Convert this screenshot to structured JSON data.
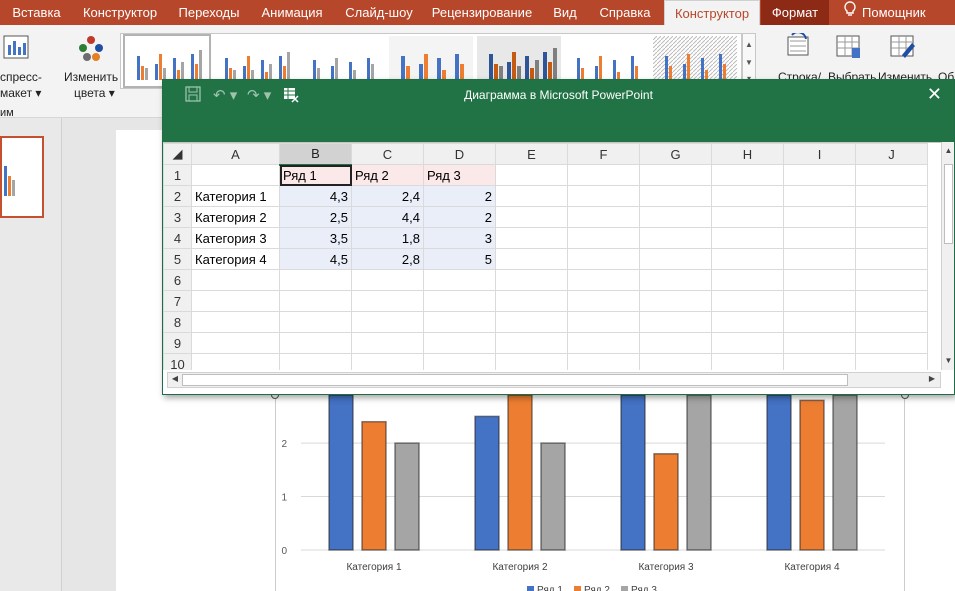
{
  "ribbon": {
    "tabs": [
      "Вставка",
      "Конструктор",
      "Переходы",
      "Анимация",
      "Слайд-шоу",
      "Рецензирование",
      "Вид",
      "Справка",
      "Конструктор",
      "Формат",
      "Помощник"
    ],
    "active_tab_index": 8,
    "left_group": {
      "line1": "спресс-",
      "line2": "макет",
      "line3": "им"
    },
    "change_colors": {
      "line1": "Изменить",
      "line2": "цвета"
    },
    "right_buttons": [
      "Строка/",
      "Выбрать",
      "Изменить",
      "Об"
    ],
    "colors": {
      "tab_bar": "#b7472a",
      "format_tab": "#8c2a16"
    }
  },
  "excel": {
    "title": "Диаграмма в Microsoft PowerPoint",
    "columns": [
      "A",
      "B",
      "C",
      "D",
      "E",
      "F",
      "G",
      "H",
      "I",
      "J"
    ],
    "rows": [
      [
        "",
        "Ряд 1",
        "Ряд 2",
        "Ряд 3",
        "",
        "",
        "",
        "",
        "",
        ""
      ],
      [
        "Категория 1",
        "4,3",
        "2,4",
        "2",
        "",
        "",
        "",
        "",
        "",
        ""
      ],
      [
        "Категория 2",
        "2,5",
        "4,4",
        "2",
        "",
        "",
        "",
        "",
        "",
        ""
      ],
      [
        "Категория 3",
        "3,5",
        "1,8",
        "3",
        "",
        "",
        "",
        "",
        "",
        ""
      ],
      [
        "Категория 4",
        "4,5",
        "2,8",
        "5",
        "",
        "",
        "",
        "",
        "",
        ""
      ],
      [
        "",
        "",
        "",
        "",
        "",
        "",
        "",
        "",
        "",
        ""
      ],
      [
        "",
        "",
        "",
        "",
        "",
        "",
        "",
        "",
        "",
        ""
      ],
      [
        "",
        "",
        "",
        "",
        "",
        "",
        "",
        "",
        "",
        ""
      ],
      [
        "",
        "",
        "",
        "",
        "",
        "",
        "",
        "",
        "",
        ""
      ],
      [
        "",
        "",
        "",
        "",
        "",
        "",
        "",
        "",
        "",
        ""
      ]
    ],
    "row_numbers": [
      "1",
      "2",
      "3",
      "4",
      "5",
      "6",
      "7",
      "8",
      "9",
      "10"
    ],
    "header_color": "#217346"
  },
  "chart_data": {
    "type": "bar",
    "categories": [
      "Категория 1",
      "Категория 2",
      "Категория 3",
      "Категория 4"
    ],
    "series": [
      {
        "name": "Ряд 1",
        "values": [
          4.3,
          2.5,
          3.5,
          4.5
        ],
        "color": "#4472c4"
      },
      {
        "name": "Ряд 2",
        "values": [
          2.4,
          4.4,
          1.8,
          2.8
        ],
        "color": "#ed7d31"
      },
      {
        "name": "Ряд 3",
        "values": [
          2,
          2,
          3,
          5
        ],
        "color": "#a5a5a5"
      }
    ],
    "ytick_labels": [
      "0",
      "1",
      "2"
    ],
    "ylim": [
      0,
      2.9
    ],
    "grid": true,
    "legend": "bottom"
  }
}
